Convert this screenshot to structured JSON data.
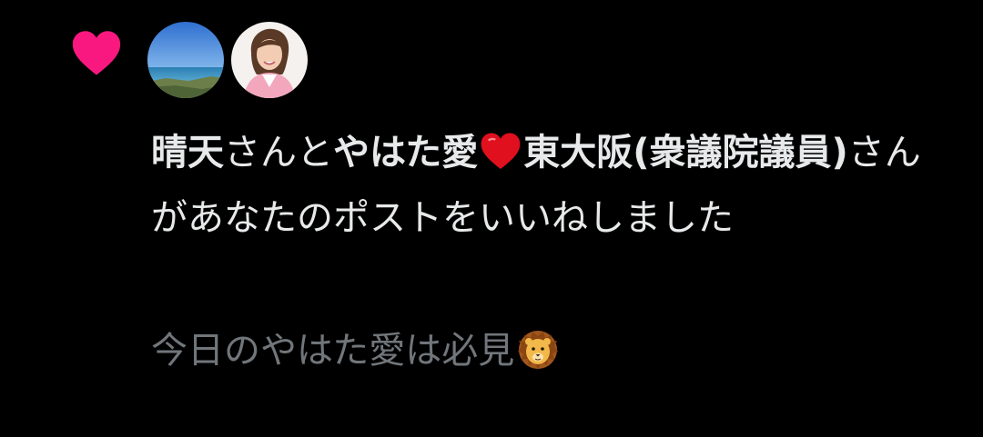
{
  "notification": {
    "type_icon": "heart-icon",
    "type_icon_color": "#f91880",
    "avatars": [
      {
        "name": "sea-landscape-avatar"
      },
      {
        "name": "woman-portrait-avatar"
      }
    ],
    "user1_name": "晴天",
    "joiner": "さんと",
    "user2_name_before": "やはた愛",
    "user2_name_after": "東大阪(衆議院議員)",
    "user2_name_emoji": "heart-icon",
    "action_text": "さんがあなたのポストをいいねしました",
    "post_text": "今日のやはた愛は必見",
    "post_emoji": "lion-icon"
  },
  "colors": {
    "background": "#000000",
    "primary_text": "#e7e9ea",
    "secondary_text": "#71767b",
    "like_pink": "#f91880",
    "emoji_red": "#e0101f"
  }
}
